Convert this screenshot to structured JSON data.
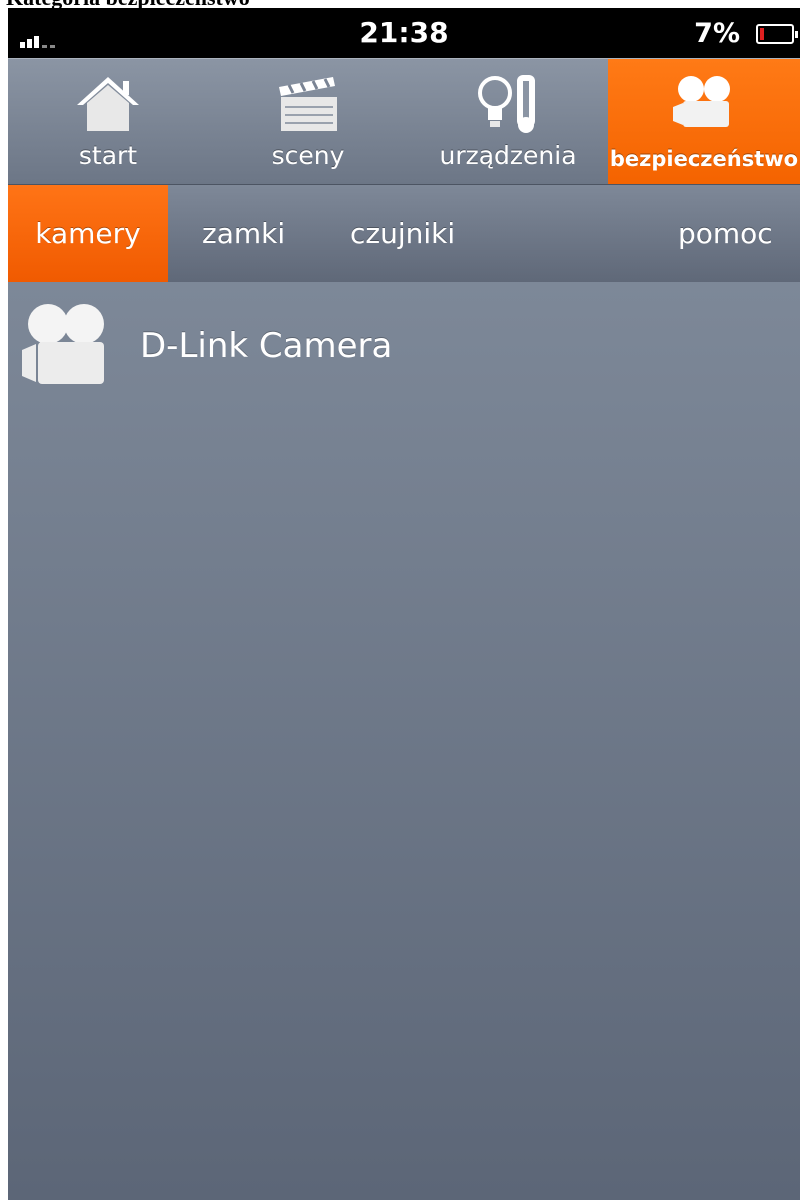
{
  "caption": "Kategoria bezpieczeństwo",
  "status_bar": {
    "time": "21:38",
    "battery_percent": "7%",
    "battery_level": 0.07,
    "signal_bars": 3
  },
  "top_nav": {
    "items": [
      {
        "label": "start",
        "icon": "house-icon"
      },
      {
        "label": "sceny",
        "icon": "clapperboard-icon"
      },
      {
        "label": "urządzenia",
        "icon": "bulb-thermometer-icon"
      },
      {
        "label": "bezpieczeństwo",
        "icon": "camera-icon",
        "active": true
      }
    ]
  },
  "sub_nav": {
    "items": [
      {
        "label": "kamery",
        "active": true
      },
      {
        "label": "zamki"
      },
      {
        "label": "czujniki"
      },
      {
        "label": "pomoc"
      }
    ]
  },
  "cameras": [
    {
      "name": "D-Link Camera",
      "icon": "camera-icon"
    }
  ],
  "colors": {
    "accent": "#f46300",
    "nav_bg": "#7a8494",
    "content_bg": "#6a7485"
  }
}
